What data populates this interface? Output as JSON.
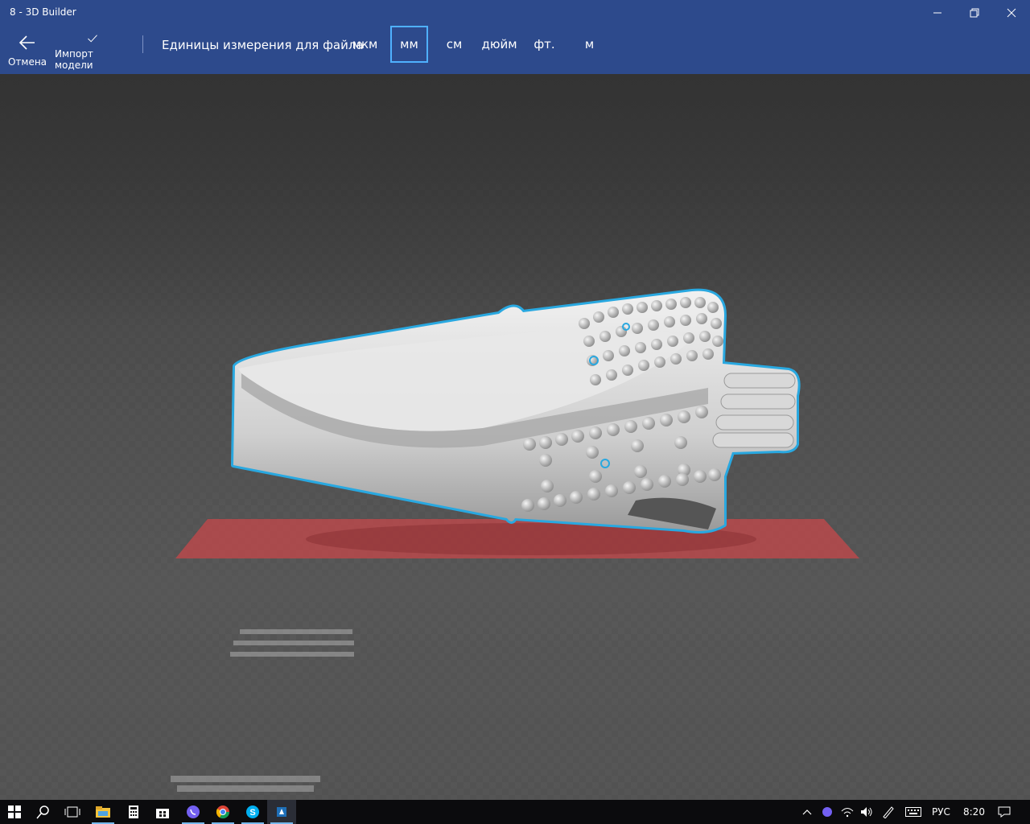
{
  "window": {
    "title": "8 - 3D Builder",
    "controls": [
      "minimize",
      "restore",
      "close"
    ]
  },
  "toolbar": {
    "cancel_label": "Отмена",
    "import_label": "Импорт модели",
    "units_label": "Единицы измерения для файла",
    "units": [
      "мкм",
      "мм",
      "см",
      "дюйм",
      "фт.",
      "м"
    ],
    "selected_unit": "мм"
  },
  "colors": {
    "title_bar": "#2d4a8c",
    "selection_outline": "#29a8e0",
    "build_plate": "#c0494a",
    "active_unit_border": "#4fb1ff"
  },
  "taskbar": {
    "apps": [
      "start-icon",
      "search-icon",
      "task-view-icon",
      "file-explorer-icon",
      "calculator-icon",
      "store-icon",
      "viber-icon",
      "chrome-icon",
      "skype-icon",
      "3d-builder-icon"
    ],
    "language": "РУС",
    "time": "8:20"
  }
}
